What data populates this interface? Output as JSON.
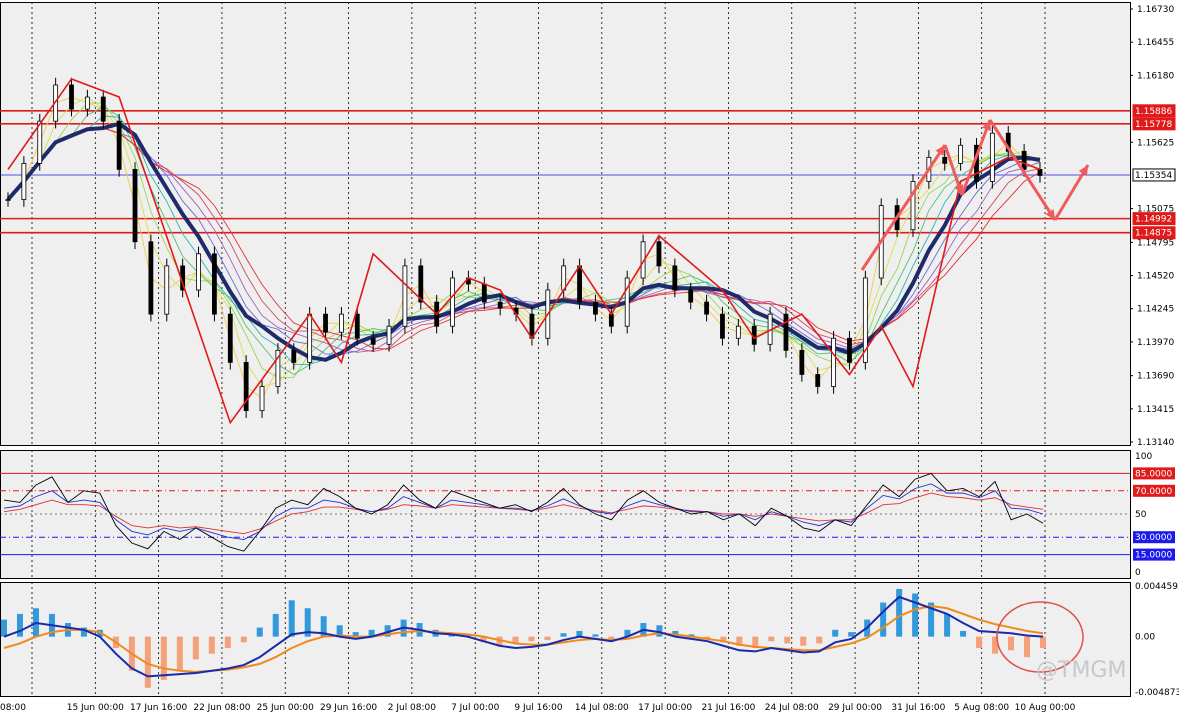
{
  "watermark": "@TMGM",
  "x_labels": [
    "08:00",
    "15 Jun 00:00",
    "17 Jun 16:00",
    "22 Jun 08:00",
    "25 Jun 00:00",
    "29 Jun 16:00",
    "2 Jul 08:00",
    "7 Jul 00:00",
    "9 Jul 16:00",
    "14 Jul 08:00",
    "17 Jul 00:00",
    "21 Jul 16:00",
    "24 Jul 08:00",
    "29 Jul 00:00",
    "31 Jul 16:00",
    "5 Aug 08:00",
    "10 Aug 00:00"
  ],
  "colors": {
    "up_hist": "#3399dd",
    "down_hist": "#f4a07a",
    "red_level": "#e01a1a",
    "blue_level": "#1a1aee",
    "ema_thick": "#1f2a6b",
    "signal": "#f08a1c",
    "zigzag": "#e01a1a",
    "arrow": "#f05a5a"
  },
  "chart_data": [
    {
      "type": "line",
      "panel": "price",
      "y_ticks": [
        "1.16730",
        "1.16455",
        "1.16180",
        "1.15625",
        "1.15075",
        "1.14795",
        "1.14520",
        "1.14245",
        "1.13970",
        "1.13690",
        "1.13415",
        "1.13140"
      ],
      "ylim": [
        1.1314,
        1.1673
      ],
      "horizontal_levels": [
        {
          "value": 1.15886,
          "label": "1.15886",
          "color": "#e01a1a"
        },
        {
          "value": 1.15778,
          "label": "1.15778",
          "color": "#e01a1a"
        },
        {
          "value": 1.15354,
          "label": "1.15354",
          "color": "#1a1aee"
        },
        {
          "value": 1.14992,
          "label": "1.14992",
          "color": "#e01a1a"
        },
        {
          "value": 1.14875,
          "label": "1.14875",
          "color": "#e01a1a"
        }
      ],
      "price_series": [
        1.1515,
        1.1545,
        1.158,
        1.161,
        1.159,
        1.16,
        1.158,
        1.154,
        1.148,
        1.142,
        1.146,
        1.144,
        1.147,
        1.142,
        1.138,
        1.134,
        1.136,
        1.139,
        1.138,
        1.142,
        1.1405,
        1.142,
        1.14,
        1.1395,
        1.141,
        1.146,
        1.143,
        1.141,
        1.145,
        1.1445,
        1.143,
        1.1425,
        1.142,
        1.14,
        1.144,
        1.146,
        1.143,
        1.142,
        1.141,
        1.145,
        1.148,
        1.146,
        1.144,
        1.143,
        1.142,
        1.14,
        1.141,
        1.1395,
        1.142,
        1.139,
        1.137,
        1.136,
        1.14,
        1.138,
        1.145,
        1.151,
        1.149,
        1.153,
        1.155,
        1.1545,
        1.156,
        1.153,
        1.157,
        1.1555,
        1.154,
        1.1535
      ],
      "zigzag": [
        [
          0,
          1.154
        ],
        [
          4,
          1.1615
        ],
        [
          7,
          1.16
        ],
        [
          14,
          1.133
        ],
        [
          19,
          1.142
        ],
        [
          21,
          1.138
        ],
        [
          23,
          1.147
        ],
        [
          27,
          1.142
        ],
        [
          29,
          1.145
        ],
        [
          31,
          1.144
        ],
        [
          33,
          1.14
        ],
        [
          36,
          1.146
        ],
        [
          38,
          1.142
        ],
        [
          41,
          1.1485
        ],
        [
          45,
          1.144
        ],
        [
          47,
          1.14
        ],
        [
          50,
          1.142
        ],
        [
          53,
          1.137
        ],
        [
          55,
          1.141
        ],
        [
          57,
          1.136
        ],
        [
          60,
          1.153
        ],
        [
          63,
          1.155
        ],
        [
          65,
          1.154
        ]
      ]
    },
    {
      "type": "line",
      "panel": "oscillator",
      "y_ticks": [
        "100",
        "50",
        "0"
      ],
      "ylim": [
        0,
        100
      ],
      "levels": [
        {
          "value": 85,
          "label": "85.0000",
          "color": "#e01a1a"
        },
        {
          "value": 70,
          "label": "70.0000",
          "color": "#e01a1a"
        },
        {
          "value": 30,
          "label": "30.0000",
          "color": "#1a1aee"
        },
        {
          "value": 15,
          "label": "15.0000",
          "color": "#1a1aee"
        }
      ],
      "series_black": [
        62,
        60,
        75,
        82,
        60,
        70,
        68,
        40,
        25,
        20,
        35,
        28,
        38,
        30,
        22,
        18,
        35,
        55,
        62,
        58,
        72,
        65,
        55,
        50,
        58,
        75,
        62,
        55,
        70,
        65,
        60,
        55,
        58,
        52,
        60,
        72,
        58,
        50,
        45,
        62,
        70,
        60,
        55,
        50,
        52,
        45,
        50,
        40,
        55,
        48,
        38,
        35,
        45,
        40,
        58,
        75,
        65,
        80,
        85,
        70,
        72,
        65,
        78,
        45,
        50,
        42
      ],
      "series_blue": [
        55,
        57,
        65,
        70,
        60,
        62,
        60,
        45,
        35,
        32,
        38,
        35,
        38,
        34,
        30,
        28,
        35,
        48,
        55,
        55,
        62,
        60,
        55,
        52,
        55,
        65,
        60,
        55,
        62,
        60,
        58,
        55,
        55,
        53,
        57,
        63,
        57,
        52,
        50,
        57,
        62,
        58,
        55,
        52,
        52,
        48,
        50,
        45,
        52,
        48,
        43,
        40,
        45,
        43,
        55,
        66,
        63,
        72,
        76,
        68,
        68,
        64,
        70,
        55,
        54,
        50
      ],
      "series_red": [
        52,
        54,
        58,
        62,
        58,
        58,
        57,
        48,
        40,
        38,
        40,
        38,
        39,
        37,
        35,
        33,
        37,
        44,
        50,
        52,
        56,
        56,
        54,
        52,
        54,
        58,
        57,
        55,
        58,
        57,
        56,
        55,
        54,
        53,
        55,
        58,
        55,
        53,
        51,
        54,
        57,
        56,
        54,
        53,
        52,
        50,
        50,
        48,
        50,
        48,
        46,
        44,
        45,
        45,
        51,
        58,
        59,
        64,
        68,
        65,
        64,
        62,
        64,
        58,
        56,
        54
      ]
    },
    {
      "type": "bar",
      "panel": "macd",
      "y_ticks": [
        "0.0044593",
        "0.00",
        "-0.004873"
      ],
      "ylim": [
        -0.004873,
        0.0044593
      ],
      "histogram": [
        0.0015,
        0.002,
        0.0025,
        0.002,
        0.0012,
        0.0008,
        0.0006,
        -0.001,
        -0.003,
        -0.0045,
        -0.0038,
        -0.003,
        -0.002,
        -0.0015,
        -0.001,
        -0.0005,
        0.0008,
        0.002,
        0.0032,
        0.0025,
        0.0018,
        0.001,
        0.0004,
        0.0006,
        0.001,
        0.0015,
        0.0012,
        0.0006,
        0.0003,
        0.0001,
        -0.0005,
        -0.0008,
        -0.0006,
        -0.0004,
        -0.0003,
        0.0003,
        0.0005,
        0.0002,
        -0.0003,
        0.0006,
        0.0012,
        0.001,
        0.0005,
        0.0002,
        -0.0002,
        -0.0005,
        -0.0008,
        -0.001,
        -0.0004,
        -0.0006,
        -0.0008,
        -0.0006,
        0.0006,
        0.0004,
        0.0015,
        0.003,
        0.0042,
        0.0038,
        0.003,
        0.002,
        0.0005,
        -0.001,
        -0.0015,
        -0.0012,
        -0.0018,
        -0.001
      ],
      "macd_line": [
        0.0,
        0.0005,
        0.0012,
        0.001,
        0.0008,
        0.0006,
        0.0,
        -0.0015,
        -0.0028,
        -0.0035,
        -0.0034,
        -0.0033,
        -0.0032,
        -0.003,
        -0.0028,
        -0.0025,
        -0.0018,
        -0.0008,
        0.0002,
        0.0004,
        0.0003,
        0.0,
        -0.0002,
        0.0,
        0.0004,
        0.0008,
        0.0006,
        0.0003,
        0.0002,
        0.0,
        -0.0004,
        -0.0008,
        -0.001,
        -0.0009,
        -0.0007,
        -0.0003,
        0.0,
        -0.0002,
        -0.0004,
        0.0,
        0.0006,
        0.0004,
        0.0,
        -0.0002,
        -0.0004,
        -0.0008,
        -0.0012,
        -0.0013,
        -0.001,
        -0.0012,
        -0.0014,
        -0.0013,
        -0.0005,
        -0.0002,
        0.0008,
        0.0022,
        0.0035,
        0.003,
        0.0025,
        0.002,
        0.0012,
        0.0005,
        0.0004,
        0.0003,
        0.0001,
        0.0
      ],
      "signal_line": [
        -0.001,
        -0.0006,
        0.0,
        0.0004,
        0.0006,
        0.0006,
        0.0004,
        -0.0005,
        -0.0015,
        -0.0024,
        -0.0028,
        -0.003,
        -0.0031,
        -0.003,
        -0.0029,
        -0.0027,
        -0.0024,
        -0.0018,
        -0.001,
        -0.0004,
        0.0,
        0.0001,
        0.0,
        0.0,
        0.0002,
        0.0004,
        0.0005,
        0.0004,
        0.0003,
        0.0002,
        0.0,
        -0.0003,
        -0.0006,
        -0.0007,
        -0.0007,
        -0.0005,
        -0.0003,
        -0.0002,
        -0.0003,
        -0.0002,
        0.0001,
        0.0003,
        0.0002,
        0.0,
        -0.0002,
        -0.0004,
        -0.0007,
        -0.0009,
        -0.001,
        -0.0011,
        -0.0012,
        -0.0012,
        -0.0009,
        -0.0006,
        -0.0001,
        0.0008,
        0.0018,
        0.0024,
        0.0027,
        0.0025,
        0.002,
        0.0015,
        0.0011,
        0.0008,
        0.0005,
        0.0003
      ]
    }
  ]
}
